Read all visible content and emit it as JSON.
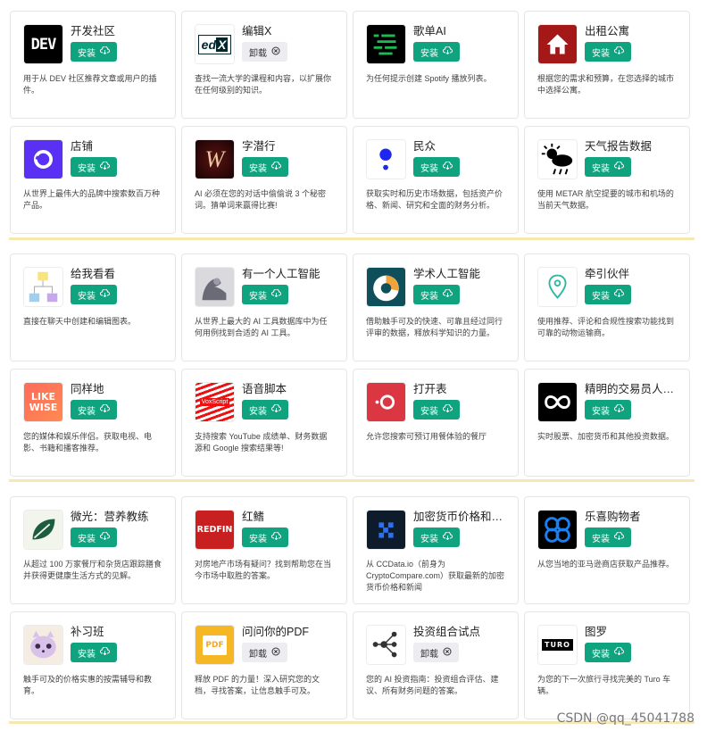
{
  "sections": [
    {
      "cards": [
        {
          "name": "开发社区",
          "button": "安装",
          "state": "install",
          "desc": "用于从 DEV 社区推荐文章或用户的插件。",
          "icon": "dev-logo",
          "logo_text": "DEV"
        },
        {
          "name": "编辑X",
          "button": "卸载",
          "state": "uninstall",
          "desc": "查找一流大学的课程和内容，以扩展你在任何级别的知识。",
          "icon": "edx-logo",
          "logo_text": "edX"
        },
        {
          "name": "歌单AI",
          "button": "安装",
          "state": "install",
          "desc": "为任何提示创建 Spotify 播放列表。",
          "icon": "playlist-logo",
          "logo_text": ""
        },
        {
          "name": "出租公寓",
          "button": "安装",
          "state": "install",
          "desc": "根据您的需求和预算，在您选择的城市中选择公寓。",
          "icon": "house-logo",
          "logo_text": ""
        },
        {
          "name": "店铺",
          "button": "安装",
          "state": "install",
          "desc": "从世界上最伟大的品牌中搜索数百万种产品。",
          "icon": "shop-logo",
          "logo_text": ""
        },
        {
          "name": "字潜行",
          "button": "安装",
          "state": "install",
          "desc": "AI 必须在您的对话中偷偷说 3 个秘密词。猜单词来赢得比赛!",
          "icon": "wordsneak-logo",
          "logo_text": "W"
        },
        {
          "name": "民众",
          "button": "安装",
          "state": "install",
          "desc": "获取实时和历史市场数据，包括资产价格、新闻、研究和全面的财务分析。",
          "icon": "polygon-logo",
          "logo_text": ""
        },
        {
          "name": "天气报告数据",
          "button": "安装",
          "state": "install",
          "desc": "使用 METAR 航空提要的城市和机场的当前天气数据。",
          "icon": "weather-logo",
          "logo_text": ""
        }
      ]
    },
    {
      "cards": [
        {
          "name": "给我看看",
          "button": "安装",
          "state": "install",
          "desc": "直接在聊天中创建和编辑图表。",
          "icon": "diagram-logo",
          "logo_text": ""
        },
        {
          "name": "有一个人工智能",
          "button": "安装",
          "state": "install",
          "desc": "从世界上最大的 AI 工具数据库中为任何用例找到合适的 AI 工具。",
          "icon": "arm-logo",
          "logo_text": ""
        },
        {
          "name": "学术人工智能",
          "button": "安装",
          "state": "install",
          "desc": "借助触手可及的快速、可靠且经过同行评审的数据，释放科学知识的力量。",
          "icon": "scholar-logo",
          "logo_text": ""
        },
        {
          "name": "牵引伙伴",
          "button": "安装",
          "state": "install",
          "desc": "使用推荐、评论和合规性搜索功能找到可靠的动物运输商。",
          "icon": "map-pin-logo",
          "logo_text": ""
        },
        {
          "name": "同样地",
          "button": "安装",
          "state": "install",
          "desc": "您的媒体和娱乐伴侣。获取电视、电影、书籍和播客推荐。",
          "icon": "likewise-logo",
          "logo_text": "LIKE WISE"
        },
        {
          "name": "语音脚本",
          "button": "安装",
          "state": "install",
          "desc": "支持搜索 YouTube 成绩单、财务数据源和 Google 搜索结果等!",
          "icon": "voxscript-logo",
          "logo_text": "VoxScript"
        },
        {
          "name": "打开表",
          "button": "安装",
          "state": "install",
          "desc": "允许您搜索可预订用餐体验的餐厅",
          "icon": "opentable-logo",
          "logo_text": ""
        },
        {
          "name": "精明的交易员人工智能",
          "button": "安装",
          "state": "install",
          "desc": "实时股票、加密货币和其他投资数据。",
          "icon": "infinity-logo",
          "logo_text": ""
        }
      ]
    },
    {
      "cards": [
        {
          "name": "微光：营养教练",
          "button": "安装",
          "state": "install",
          "desc": "从超过 100 万家餐厅和杂货店跟踪膳食并获得更健康生活方式的见解。",
          "icon": "leaf-logo",
          "logo_text": ""
        },
        {
          "name": "红鳍",
          "button": "安装",
          "state": "install",
          "desc": "对房地产市场有疑问？找到帮助您在当今市场中取胜的答案。",
          "icon": "redfin-logo",
          "logo_text": "REDFIN"
        },
        {
          "name": "加密货币价格和新闻",
          "button": "安装",
          "state": "install",
          "desc": "从 CCData.io（前身为 CryptoCompare.com）获取最新的加密货币价格和新闻",
          "icon": "crypto-logo",
          "logo_text": ""
        },
        {
          "name": "乐喜购物者",
          "button": "安装",
          "state": "install",
          "desc": "从您当地的亚马逊商店获取产品推荐。",
          "icon": "knot-logo",
          "logo_text": ""
        },
        {
          "name": "补习班",
          "button": "安装",
          "state": "install",
          "desc": "触手可及的价格实惠的按需辅导和教育。",
          "icon": "cat-logo",
          "logo_text": ""
        },
        {
          "name": "问问你的PDF",
          "button": "卸载",
          "state": "uninstall",
          "desc": "释放 PDF 的力量！深入研究您的文档，寻找答案，让信息触手可及。",
          "icon": "pdf-logo",
          "logo_text": "PDF"
        },
        {
          "name": "投资组合试点",
          "button": "卸载",
          "state": "uninstall",
          "desc": "您的 AI 投资指南：投资组合评估、建议、所有财务问题的答案。",
          "icon": "network-logo",
          "logo_text": ""
        },
        {
          "name": "图罗",
          "button": "安装",
          "state": "install",
          "desc": "为您的下一次旅行寻找完美的 Turo 车辆。",
          "icon": "turo-logo",
          "logo_text": "TURO"
        }
      ]
    }
  ],
  "watermark": "CSDN @qq_45041788",
  "colors": {
    "install": "#10a37f",
    "uninstall": "#ececf1",
    "divider": "#f6e7b3"
  }
}
